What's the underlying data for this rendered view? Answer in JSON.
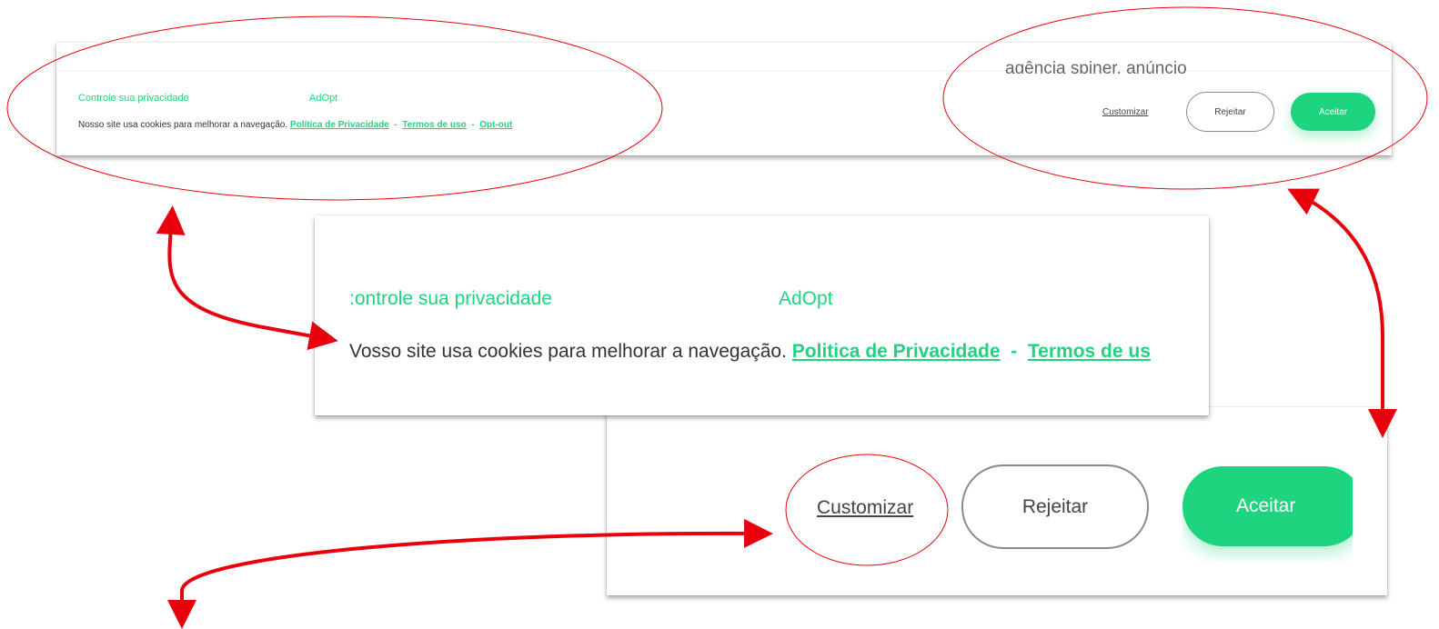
{
  "banner": {
    "ad_text": "agência spiner, anúncio",
    "title": "Controle sua privacidade",
    "brand": "AdOpt",
    "message": "Nosso site usa cookies para melhorar a navegação.",
    "privacy_link": "Política de Privacidade",
    "terms_link": "Termos de uso",
    "optout_link": "Opt-out",
    "separator": "-",
    "customize_label": "Customizar",
    "reject_label": "Rejeitar",
    "accept_label": "Aceitar"
  },
  "zoom_text": {
    "title": ":ontrole sua privacidade",
    "brand": "AdOpt",
    "message": "Vosso site usa cookies para melhorar a navegação.",
    "privacy_link": "Politica de Privacidade",
    "terms_link": "Termos de us",
    "separator": "-"
  },
  "zoom_buttons": {
    "customize_label": "Customizar",
    "reject_label": "Rejeitar",
    "accept_label": "Aceitar"
  },
  "colors": {
    "accent": "#1ed47e",
    "annotation": "#e8000b"
  }
}
